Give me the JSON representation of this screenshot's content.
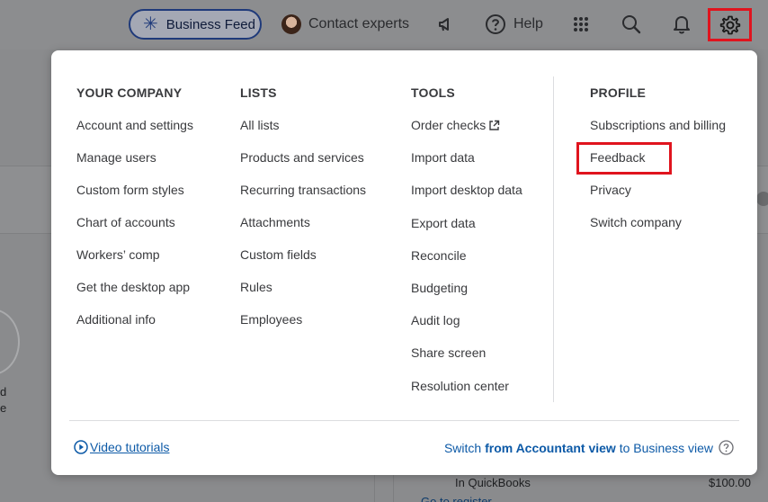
{
  "topbar": {
    "business_feed_label": "Business Feed",
    "contact_label": "Contact experts",
    "help_label": "Help"
  },
  "background": {
    "left_text_1": "d",
    "left_text_2": "e",
    "bottom_text": "In QuickBooks",
    "bottom_amount": "$100.00",
    "bottom_link": "Go to register"
  },
  "menu": {
    "columns": [
      {
        "title": "YOUR COMPANY",
        "items": [
          "Account and settings",
          "Manage users",
          "Custom form styles",
          "Chart of accounts",
          "Workers’ comp",
          "Get the desktop app",
          "Additional info"
        ]
      },
      {
        "title": "LISTS",
        "items": [
          "All lists",
          "Products and services",
          "Recurring transactions",
          "Attachments",
          "Custom fields",
          "Rules",
          "Employees"
        ]
      },
      {
        "title": "TOOLS",
        "items": [
          "Order checks",
          "Import data",
          "Import desktop data",
          "Export data",
          "Reconcile",
          "Budgeting",
          "Audit log",
          "Share screen",
          "Resolution center"
        ]
      },
      {
        "title": "PROFILE",
        "items": [
          "Subscriptions and billing",
          "Feedback",
          "Privacy",
          "Switch company"
        ]
      }
    ],
    "footer": {
      "video_tutorials": "Video tutorials",
      "switch_prefix": "Switch",
      "switch_bold": "from Accountant view",
      "switch_suffix": "to Business view"
    }
  },
  "colors": {
    "link": "#0d5aa7",
    "highlight": "#e0141e"
  },
  "icons": [
    "business-feed-icon",
    "megaphone-icon",
    "help-icon",
    "apps-grid-icon",
    "search-icon",
    "bell-icon",
    "gear-icon",
    "external-link-icon",
    "play-icon",
    "question-icon"
  ]
}
